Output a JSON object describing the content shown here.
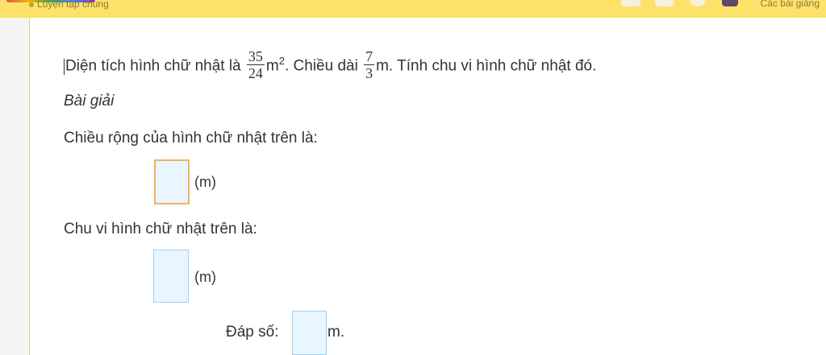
{
  "topbar": {
    "left_label": "Luyện tập chung",
    "right_label": "Các bài giảng"
  },
  "question": {
    "part1": "Diện tích hình chữ nhật là",
    "area_num": "35",
    "area_den": "24",
    "area_unit": "m",
    "area_exp": "2",
    "part2": ". Chiều dài",
    "len_num": "7",
    "len_den": "3",
    "part3": "m. Tính chu vi hình chữ nhật đó."
  },
  "solution": {
    "heading": "Bài giải",
    "width_label": "Chiều rộng của hình chữ nhật trên là:",
    "width_unit": "(m)",
    "perimeter_label": "Chu vi hình chữ nhật trên là:",
    "perimeter_unit": "(m)",
    "answer_label": "Đáp số:",
    "answer_unit": "m."
  },
  "colors": {
    "topbar": "#fde26a",
    "input_bg": "#e9f5ff",
    "input_border": "#9fd0f2",
    "active_border": "#f2b35b"
  }
}
